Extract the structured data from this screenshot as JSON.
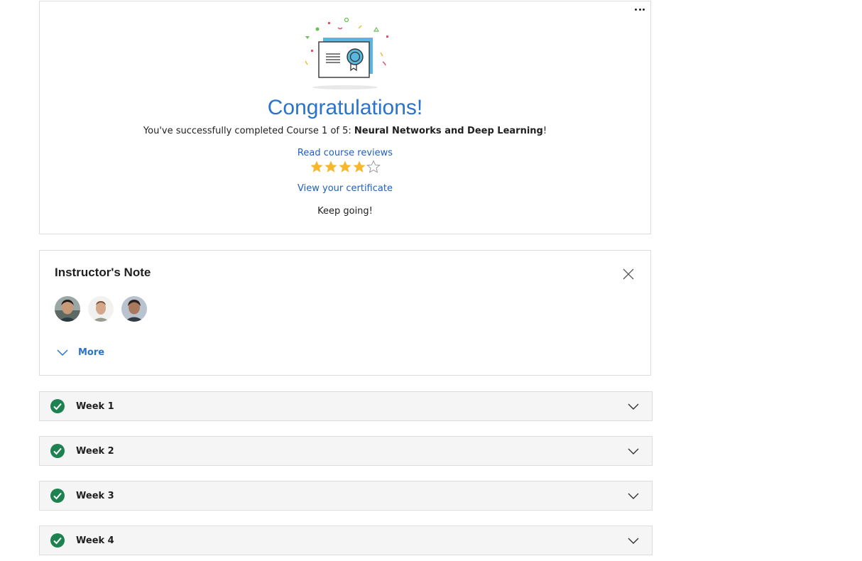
{
  "congrats": {
    "title": "Congratulations!",
    "completed_prefix": "You've successfully completed Course 1 of 5: ",
    "course_name": "Neural Networks and Deep Learning",
    "completed_suffix": "!",
    "reviews_link": "Read course reviews",
    "rating": 4,
    "rating_max": 5,
    "certificate_link": "View your certificate",
    "keep_going": "Keep going!"
  },
  "instructor_note": {
    "title": "Instructor's Note",
    "more_label": "More"
  },
  "weeks": [
    {
      "label": "Week 1",
      "status": "completed"
    },
    {
      "label": "Week 2",
      "status": "completed"
    },
    {
      "label": "Week 3",
      "status": "completed"
    },
    {
      "label": "Week 4",
      "status": "completed"
    }
  ],
  "colors": {
    "accent": "#2a73cc",
    "link": "#1f5fbf",
    "star": "#f5b82e",
    "check": "#1e8150"
  }
}
